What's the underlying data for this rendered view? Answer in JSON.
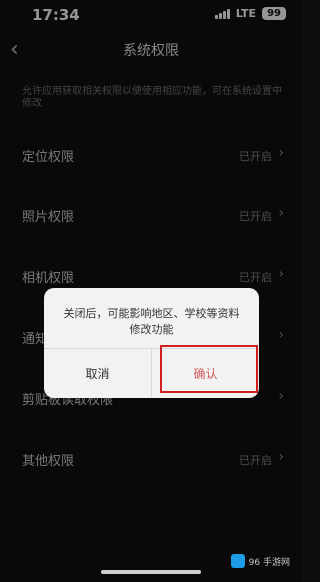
{
  "status": {
    "time": "17:34",
    "network": "LTE",
    "battery": "99"
  },
  "header": {
    "title": "系统权限"
  },
  "description": "允许应用获取相关权限以便使用相应功能，可在系统设置中修改",
  "rows": [
    {
      "label": "定位权限",
      "value": "已开启"
    },
    {
      "label": "照片权限",
      "value": "已开启"
    },
    {
      "label": "相机权限",
      "value": "已开启"
    },
    {
      "label": "通知权限",
      "value": ""
    },
    {
      "label": "剪贴板读取权限",
      "value": ""
    },
    {
      "label": "其他权限",
      "value": "已开启"
    }
  ],
  "dialog": {
    "message_line1": "关闭后，可能影响地区、学校等资料",
    "message_line2": "修改功能",
    "cancel": "取消",
    "confirm": "确认"
  },
  "watermark": {
    "text": "96 手游网"
  }
}
